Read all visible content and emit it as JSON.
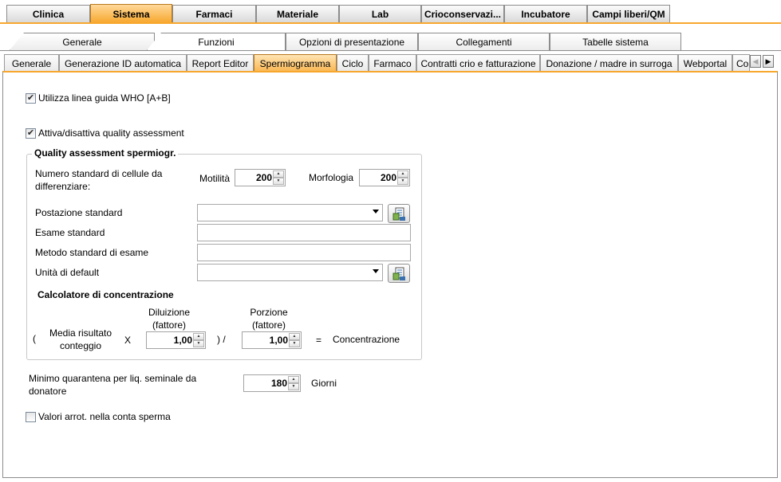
{
  "top_tabs": [
    {
      "label": "Clinica"
    },
    {
      "label": "Sistema"
    },
    {
      "label": "Farmaci"
    },
    {
      "label": "Materiale"
    },
    {
      "label": "Lab"
    },
    {
      "label": "Crioconservazi..."
    },
    {
      "label": "Incubatore"
    },
    {
      "label": "Campi liberi/QM"
    }
  ],
  "active_top_tab": "Sistema",
  "second_tabs": [
    {
      "label": "Generale"
    },
    {
      "label": "Funzioni"
    },
    {
      "label": "Opzioni di presentazione"
    },
    {
      "label": "Collegamenti"
    },
    {
      "label": "Tabelle sistema"
    }
  ],
  "active_second_tab": "Funzioni",
  "third_tabs": [
    {
      "label": "Generale"
    },
    {
      "label": "Generazione ID automatica"
    },
    {
      "label": "Report Editor"
    },
    {
      "label": "Spermiogramma"
    },
    {
      "label": "Ciclo"
    },
    {
      "label": "Farmaco"
    },
    {
      "label": "Contratti crio e fatturazione"
    },
    {
      "label": "Donazione / madre in surroga"
    },
    {
      "label": "Webportal"
    },
    {
      "label": "Co"
    }
  ],
  "active_third_tab": "Spermiogramma",
  "form": {
    "who_guideline": {
      "label": "Utilizza linea guida WHO [A+B]",
      "checked": true
    },
    "quality_assessment": {
      "label": "Attiva/disattiva quality assessment",
      "checked": true
    },
    "qa_group": {
      "title": "Quality assessment spermiogr.",
      "std_cells_label_1": "Numero standard di cellule da",
      "std_cells_label_2": "differenziare:",
      "motility_label": "Motilità",
      "motility_value": "200",
      "morphology_label": "Morfologia",
      "morphology_value": "200",
      "workstation_label": "Postazione standard",
      "workstation_value": "",
      "exam_label": "Esame standard",
      "exam_value": "",
      "method_label": "Metodo standard di esame",
      "method_value": "",
      "unit_label": "Unità di default",
      "unit_value": "",
      "calc_title": "Calcolatore di concentrazione",
      "open_paren": "(",
      "mean_label_1": "Media risultato",
      "mean_label_2": "conteggio",
      "times": "X",
      "dilution_label_1": "Diluizione",
      "dilution_label_2": "(fattore)",
      "dilution_value": "1,00",
      "divide": ") /",
      "portion_label_1": "Porzione",
      "portion_label_2": "(fattore)",
      "portion_value": "1,00",
      "equals": "=",
      "concentration_label": "Concentrazione"
    },
    "quarantine_label_1": "Minimo quarantena per liq. seminale da",
    "quarantine_label_2": "donatore",
    "quarantine_value": "180",
    "quarantine_unit": "Giorni",
    "rounded_values": {
      "label": "Valori arrot. nella conta sperma",
      "checked": false
    }
  },
  "icons": {
    "scroll_left": "scroll-left-arrow-icon",
    "scroll_right": "scroll-right-arrow-icon",
    "checkbox_check": "checkmark-icon",
    "lookup": "document-lookup-icon",
    "dropdown": "chevron-down-icon"
  },
  "colors": {
    "active_tab": "#f7a72c",
    "tab_border": "#8c8c8c"
  }
}
